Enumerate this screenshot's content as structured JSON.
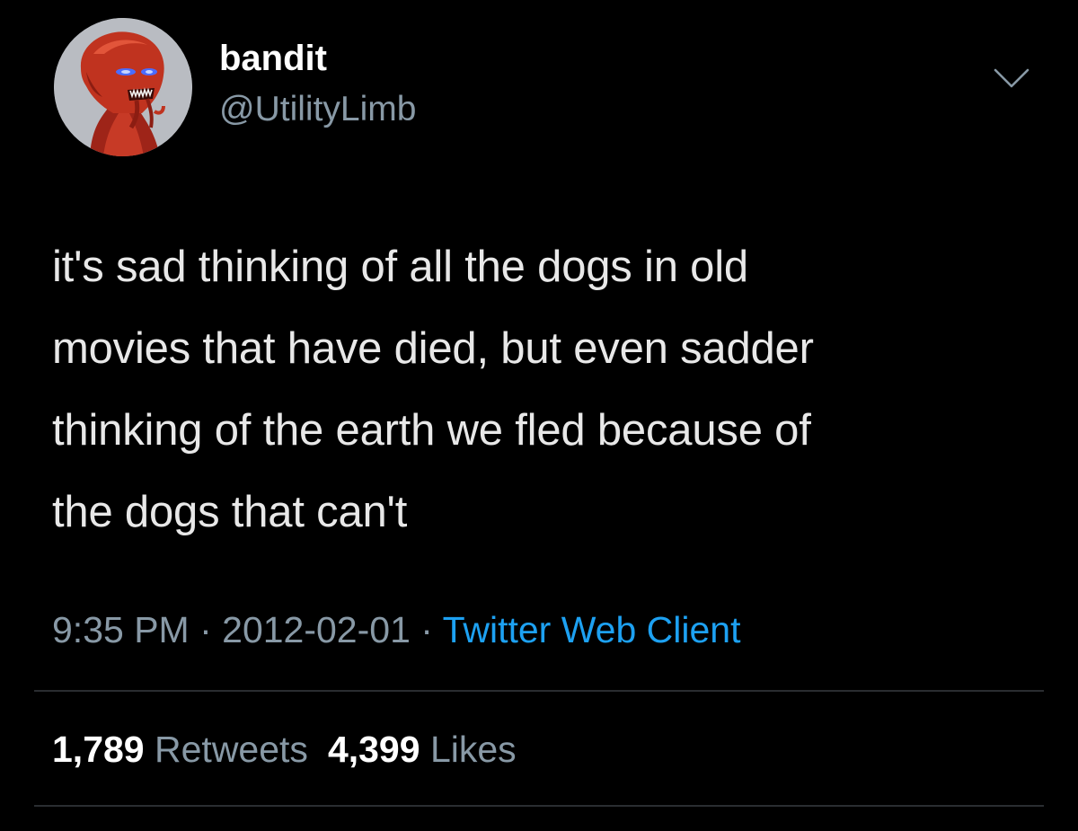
{
  "tweet": {
    "user": {
      "display_name": "bandit",
      "handle": "@UtilityLimb",
      "avatar_icon": "red-alien-creature-avatar"
    },
    "text_lines": [
      "it's sad thinking of all the dogs in old",
      "movies that have died, but even sadder",
      "thinking of the earth we fled because of",
      "the dogs that can't"
    ],
    "meta": {
      "time": "9:35 PM",
      "separator": " · ",
      "date": "2012-02-01",
      "source": "Twitter Web Client"
    },
    "stats": {
      "retweets_count": "1,789",
      "retweets_label": "Retweets",
      "likes_count": "4,399",
      "likes_label": "Likes"
    }
  },
  "colors": {
    "background": "#000000",
    "text": "#e8e8e8",
    "muted": "#8899a6",
    "link": "#1da1f2",
    "divider": "#2a2d31"
  }
}
